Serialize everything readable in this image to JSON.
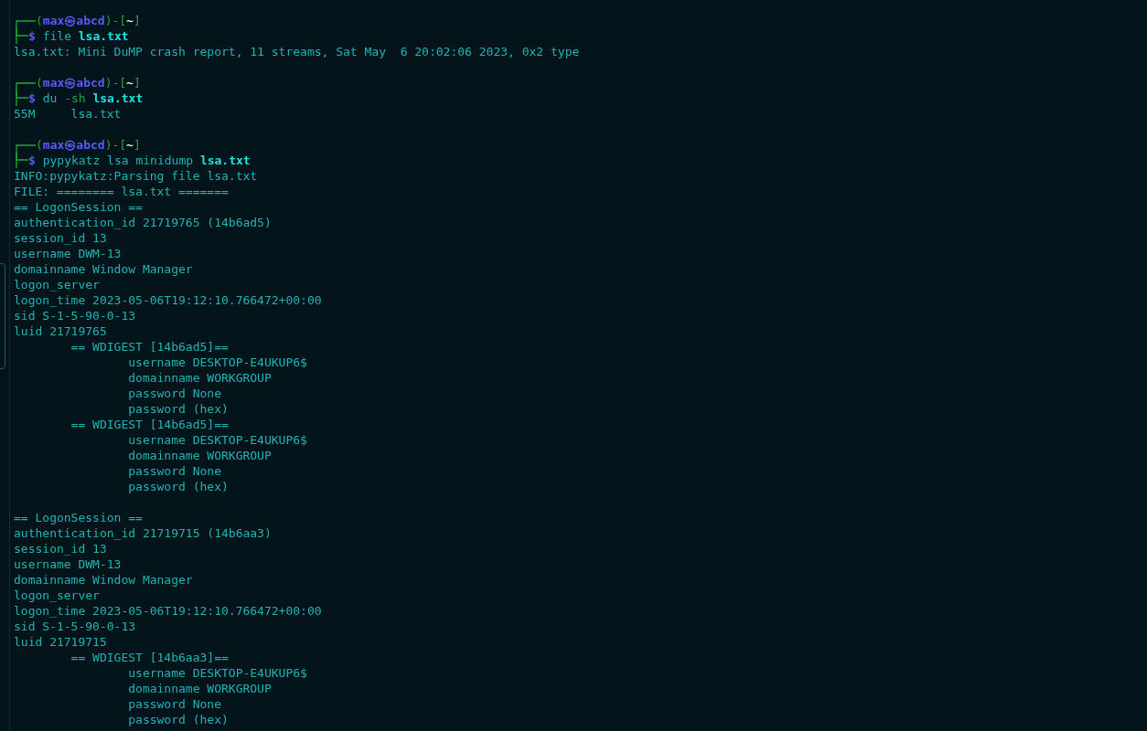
{
  "terminal": {
    "blocks": [
      {
        "prompt": {
          "parts": [
            {
              "kind": "frame",
              "text": "("
            },
            {
              "kind": "userhost",
              "text": "max㉿abcd"
            },
            {
              "kind": "frame",
              "text": ")-["
            },
            {
              "kind": "cwd",
              "text": "~"
            },
            {
              "kind": "frame",
              "text": "]"
            }
          ],
          "symbol": "$",
          "tokens": [
            {
              "kind": "cmd",
              "text": "file"
            },
            {
              "kind": "arg",
              "text": "lsa.txt"
            }
          ]
        },
        "output": [
          {
            "kind": "line",
            "text": "lsa.txt: Mini DuMP crash report, 11 streams, Sat May  6 20:02:06 2023, 0x2 type"
          }
        ]
      },
      {
        "prompt": {
          "parts": [
            {
              "kind": "frame",
              "text": "("
            },
            {
              "kind": "userhost",
              "text": "max㉿abcd"
            },
            {
              "kind": "frame",
              "text": ")-["
            },
            {
              "kind": "cwd",
              "text": "~"
            },
            {
              "kind": "frame",
              "text": "]"
            }
          ],
          "symbol": "$",
          "tokens": [
            {
              "kind": "cmd",
              "text": "du"
            },
            {
              "kind": "option",
              "text": "-sh"
            },
            {
              "kind": "arg",
              "text": "lsa.txt"
            }
          ]
        },
        "output": [
          {
            "kind": "line",
            "text": "55M     lsa.txt"
          }
        ]
      },
      {
        "prompt": {
          "parts": [
            {
              "kind": "frame",
              "text": "("
            },
            {
              "kind": "userhost",
              "text": "max㉿abcd"
            },
            {
              "kind": "frame",
              "text": ")-["
            },
            {
              "kind": "cwd",
              "text": "~"
            },
            {
              "kind": "frame",
              "text": "]"
            }
          ],
          "symbol": "$",
          "tokens": [
            {
              "kind": "cmd",
              "text": "pypykatz"
            },
            {
              "kind": "plain",
              "text": "lsa"
            },
            {
              "kind": "plain",
              "text": "minidump"
            },
            {
              "kind": "arg",
              "text": "lsa.txt"
            }
          ]
        },
        "output": [
          {
            "kind": "line",
            "text": "INFO:pypykatz:Parsing file lsa.txt"
          },
          {
            "kind": "line",
            "text": "FILE: ======== lsa.txt ======="
          },
          {
            "kind": "line",
            "text": "== LogonSession =="
          },
          {
            "kind": "line",
            "text": "authentication_id 21719765 (14b6ad5)"
          },
          {
            "kind": "line",
            "text": "session_id 13"
          },
          {
            "kind": "line",
            "text": "username DWM-13"
          },
          {
            "kind": "line",
            "text": "domainname Window Manager"
          },
          {
            "kind": "line",
            "text": "logon_server"
          },
          {
            "kind": "line",
            "text": "logon_time 2023-05-06T19:12:10.766472+00:00"
          },
          {
            "kind": "line",
            "text": "sid S-1-5-90-0-13"
          },
          {
            "kind": "line",
            "text": "luid 21719765"
          },
          {
            "kind": "line",
            "text": "        == WDIGEST [14b6ad5]=="
          },
          {
            "kind": "line",
            "text": "                username DESKTOP-E4UKUP6$"
          },
          {
            "kind": "line",
            "text": "                domainname WORKGROUP"
          },
          {
            "kind": "line",
            "text": "                password None"
          },
          {
            "kind": "line",
            "text": "                password (hex)"
          },
          {
            "kind": "line",
            "text": "        == WDIGEST [14b6ad5]=="
          },
          {
            "kind": "line",
            "text": "                username DESKTOP-E4UKUP6$"
          },
          {
            "kind": "line",
            "text": "                domainname WORKGROUP"
          },
          {
            "kind": "line",
            "text": "                password None"
          },
          {
            "kind": "line",
            "text": "                password (hex)"
          },
          {
            "kind": "blank"
          },
          {
            "kind": "line",
            "text": "== LogonSession =="
          },
          {
            "kind": "line",
            "text": "authentication_id 21719715 (14b6aa3)"
          },
          {
            "kind": "line",
            "text": "session_id 13"
          },
          {
            "kind": "line",
            "text": "username DWM-13"
          },
          {
            "kind": "line",
            "text": "domainname Window Manager"
          },
          {
            "kind": "line",
            "text": "logon_server"
          },
          {
            "kind": "line",
            "text": "logon_time 2023-05-06T19:12:10.766472+00:00"
          },
          {
            "kind": "line",
            "text": "sid S-1-5-90-0-13"
          },
          {
            "kind": "line",
            "text": "luid 21719715"
          },
          {
            "kind": "line",
            "text": "        == WDIGEST [14b6aa3]=="
          },
          {
            "kind": "line",
            "text": "                username DESKTOP-E4UKUP6$"
          },
          {
            "kind": "line",
            "text": "                domainname WORKGROUP"
          },
          {
            "kind": "line",
            "text": "                password None"
          },
          {
            "kind": "line",
            "text": "                password (hex)"
          }
        ]
      }
    ]
  }
}
